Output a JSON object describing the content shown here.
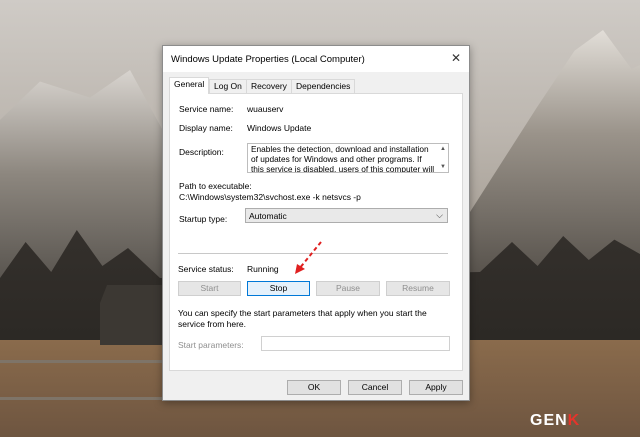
{
  "window": {
    "title": "Windows Update Properties (Local Computer)",
    "close_glyph": "✕"
  },
  "tabs": [
    {
      "label": "General",
      "active": true
    },
    {
      "label": "Log On",
      "active": false
    },
    {
      "label": "Recovery",
      "active": false
    },
    {
      "label": "Dependencies",
      "active": false
    }
  ],
  "general": {
    "service_name_label": "Service name:",
    "service_name_value": "wuauserv",
    "display_name_label": "Display name:",
    "display_name_value": "Windows Update",
    "description_label": "Description:",
    "description_value": "Enables the detection, download and installation of updates for Windows and other programs. If this service is disabled, users of this computer will not be",
    "path_label": "Path to executable:",
    "path_value": "C:\\Windows\\system32\\svchost.exe -k netsvcs -p",
    "startup_type_label": "Startup type:",
    "startup_type_value": "Automatic",
    "service_status_label": "Service status:",
    "service_status_value": "Running",
    "buttons": {
      "start": "Start",
      "stop": "Stop",
      "pause": "Pause",
      "resume": "Resume"
    },
    "start_params_help": "You can specify the start parameters that apply when you start the service from here.",
    "start_params_label": "Start parameters:",
    "start_params_value": ""
  },
  "footer": {
    "ok": "OK",
    "cancel": "Cancel",
    "apply": "Apply"
  },
  "watermark": {
    "prefix": "GEN",
    "suffix": "K"
  },
  "colors": {
    "focus_border": "#0078d7",
    "annotation_arrow": "#e02020",
    "logo_accent": "#e5342b"
  }
}
